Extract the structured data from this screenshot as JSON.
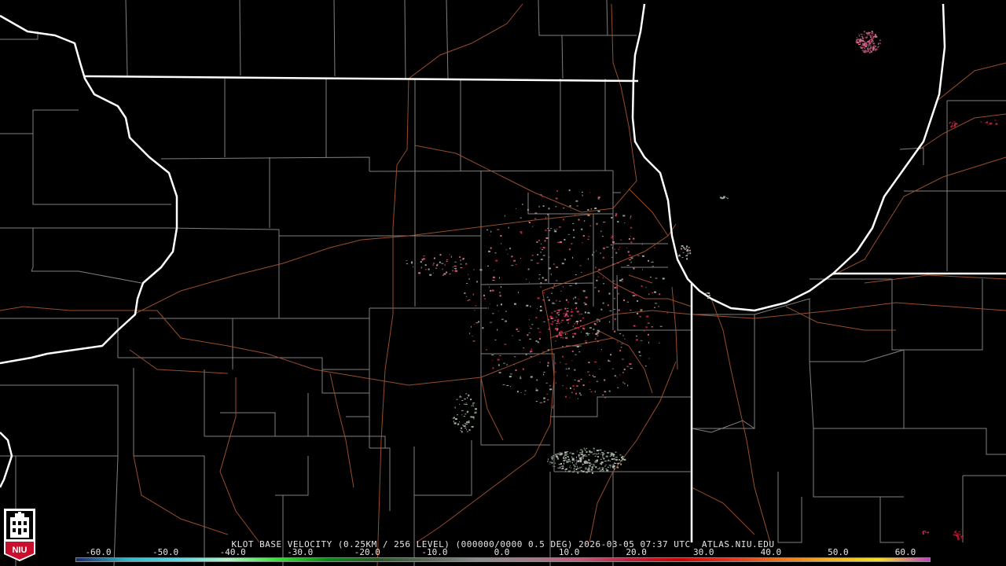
{
  "product_caption": "KLOT BASE VELOCITY (0.25KM / 256 LEVEL) (000000/0000 0.5 DEG) 2026-03-05 07:37 UTC  ATLAS.NIU.EDU",
  "logo_text": "NIU",
  "colorbar": {
    "tick_labels": [
      "-60.0",
      "-50.0",
      "-40.0",
      "-30.0",
      "-20.0",
      "-10.0",
      "0.0",
      "10.0",
      "20.0",
      "30.0",
      "40.0",
      "50.0",
      "60.0"
    ],
    "colors": [
      "#1a2a6e",
      "#2fb7c9",
      "#5ad5e0",
      "#aef0c8",
      "#37e23a",
      "#0b8a16",
      "#2a5a2a",
      "#5a6a5a",
      "#8a8a8a",
      "#a07a8a",
      "#c05a7a",
      "#c02040",
      "#d00000",
      "#e43020",
      "#f07018",
      "#f4b020",
      "#f6e020",
      "#c040c0"
    ]
  },
  "map_colors": {
    "state_boundary": "#ffffff",
    "county_boundary": "#808080",
    "highway": "#a0522d",
    "inbound": "#9aa89a",
    "outbound": "#c02040"
  }
}
